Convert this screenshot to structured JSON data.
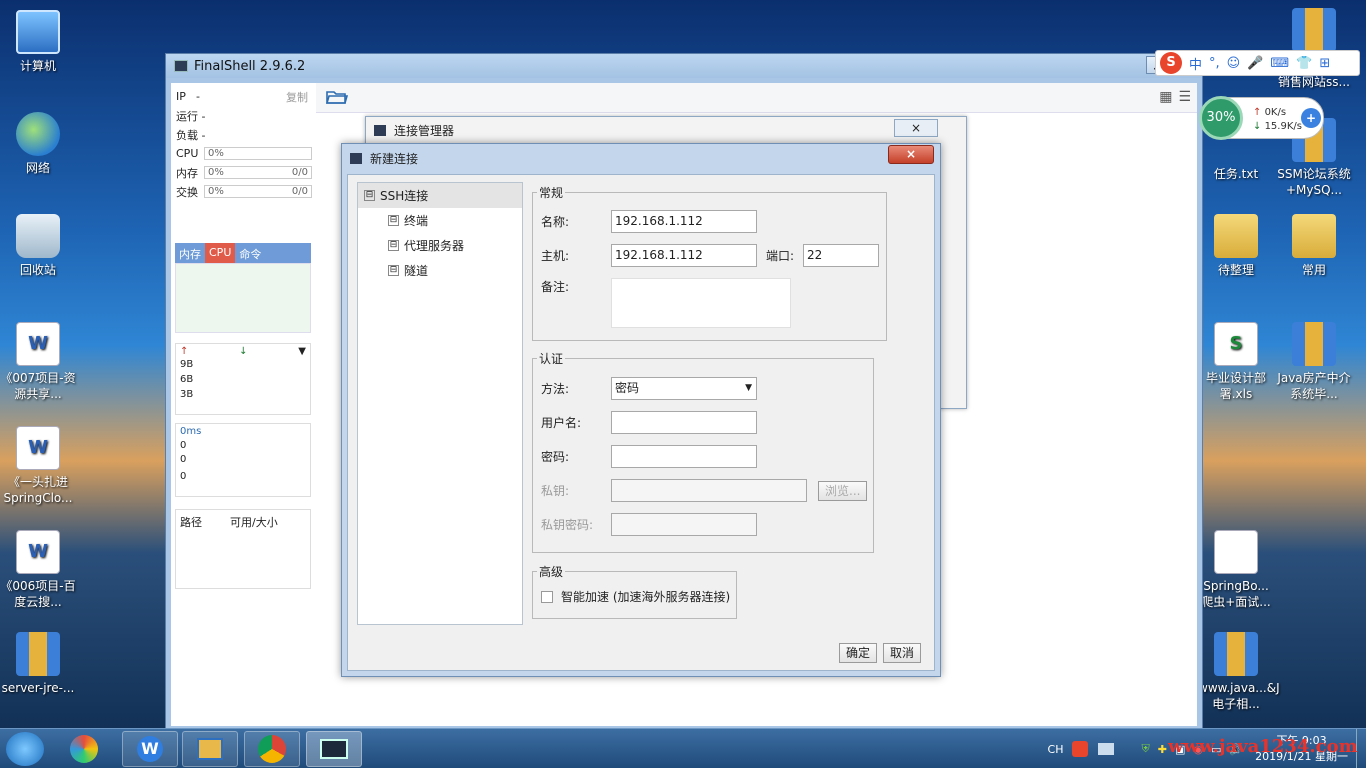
{
  "desktop": {
    "left_icons": [
      {
        "label": "计算机",
        "icon": "computer-icon"
      },
      {
        "label": "网络",
        "icon": "network-icon"
      },
      {
        "label": "回收站",
        "icon": "recycle-bin-icon"
      },
      {
        "label": "《007项目-资源共享...",
        "icon": "word-doc-icon"
      },
      {
        "label": "《一头扎进SpringClo...",
        "icon": "word-doc-icon"
      },
      {
        "label": "《006项目-百度云搜...",
        "icon": "word-doc-icon"
      },
      {
        "label": "server-jre-...",
        "icon": "rar-archive-icon"
      }
    ],
    "right_icons": [
      {
        "label": "销售网站ss...",
        "icon": "rar-archive-icon"
      },
      {
        "label": "任务.txt",
        "icon": "text-file-icon"
      },
      {
        "label": "SSM论坛系统+MySQ...",
        "icon": "rar-archive-icon"
      },
      {
        "label": "待整理",
        "icon": "folder-icon"
      },
      {
        "label": "常用",
        "icon": "folder-icon"
      },
      {
        "label": "毕业设计部署.xls",
        "icon": "excel-file-icon"
      },
      {
        "label": "Java房产中介系统毕...",
        "icon": "rar-archive-icon"
      },
      {
        "label": "SpringBo...爬虫+面试...",
        "icon": "text-file-icon"
      },
      {
        "label": "www.java...&J电子相...",
        "icon": "rar-archive-icon"
      }
    ]
  },
  "finalshell": {
    "title": "FinalShell 2.9.6.2",
    "left": {
      "ip_label": "IP",
      "ip_value": "-",
      "copy_label": "复制",
      "run_label": "运行 -",
      "load_label": "负载 -",
      "cpu_label": "CPU",
      "cpu_value": "0%",
      "mem_label": "内存",
      "mem_value": "0%",
      "mem_ratio": "0/0",
      "swap_label": "交换",
      "swap_value": "0%",
      "swap_ratio": "0/0",
      "tabs": [
        "内存",
        "CPU",
        "命令"
      ],
      "net_values": [
        "9B",
        "6B",
        "3B"
      ],
      "ping_label": "0ms",
      "ping_values": [
        "0",
        "0",
        "0"
      ],
      "disk_headers": [
        "路径",
        "可用/大小"
      ]
    }
  },
  "conn_manager": {
    "title": "连接管理器",
    "close": "×"
  },
  "new_conn": {
    "title": "新建连接",
    "close": "×",
    "tree": [
      {
        "label": "SSH连接",
        "toggle": "⊟"
      },
      {
        "label": "终端",
        "toggle": "⊟"
      },
      {
        "label": "代理服务器",
        "toggle": "⊟"
      },
      {
        "label": "隧道",
        "toggle": "⊟"
      }
    ],
    "general": {
      "legend": "常规",
      "name_label": "名称:",
      "name_value": "192.168.1.112",
      "host_label": "主机:",
      "host_value": "192.168.1.112",
      "port_label": "端口:",
      "port_value": "22",
      "note_label": "备注:"
    },
    "auth": {
      "legend": "认证",
      "method_label": "方法:",
      "method_value": "密码",
      "user_label": "用户名:",
      "password_label": "密码:",
      "key_label": "私钥:",
      "browse_label": "浏览...",
      "key_password_label": "私钥密码:"
    },
    "advanced": {
      "legend": "高级",
      "smart_accel_label": "智能加速 (加速海外服务器连接)"
    },
    "ok_label": "确定",
    "cancel_label": "取消"
  },
  "ime": {
    "lang": "中",
    "punct": "°,"
  },
  "speed_widget": {
    "percent": "30%",
    "up": "0K/s",
    "down": "15.9K/s"
  },
  "taskbar": {
    "lang": "CH",
    "time": "下午 9:03",
    "date": "2019/1/21 星期一"
  },
  "watermark": "www.java1234.com"
}
